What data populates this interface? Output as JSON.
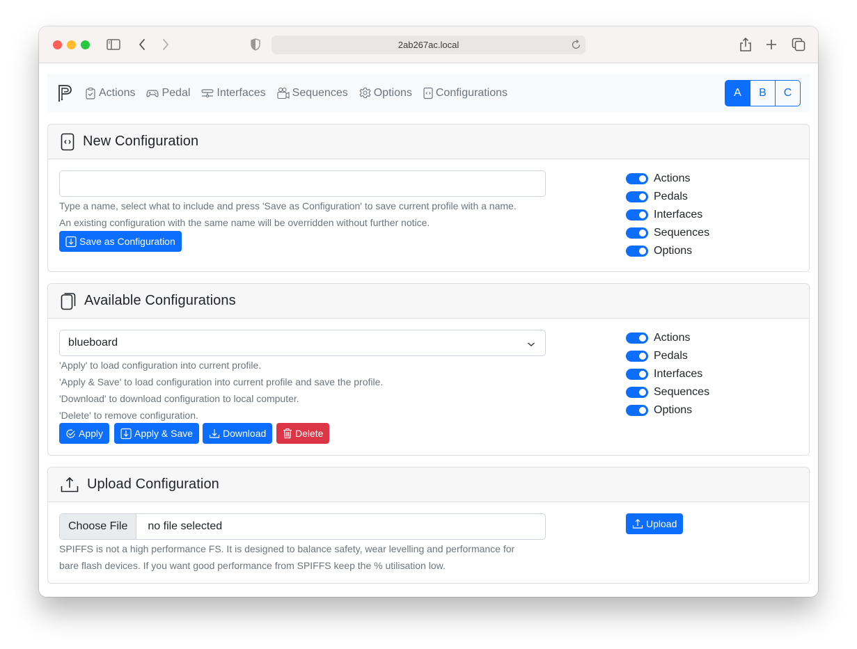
{
  "browser": {
    "url": "2ab267ac.local",
    "icons": [
      "sidebar-icon",
      "back-icon",
      "forward-icon",
      "shield-icon",
      "reload-icon",
      "share-icon",
      "new-tab-icon",
      "tabs-overview-icon"
    ]
  },
  "navbar": {
    "brand_icon": "pedal-logo-icon",
    "links": [
      {
        "label": "Actions",
        "icon": "clipboard-check-icon"
      },
      {
        "label": "Pedal",
        "icon": "controller-icon"
      },
      {
        "label": "Interfaces",
        "icon": "interfaces-icon"
      },
      {
        "label": "Sequences",
        "icon": "camera-reels-icon"
      },
      {
        "label": "Options",
        "icon": "gear-icon"
      },
      {
        "label": "Configurations",
        "icon": "file-code-icon"
      }
    ],
    "profiles": [
      {
        "label": "A",
        "active": true
      },
      {
        "label": "B",
        "active": false
      },
      {
        "label": "C",
        "active": false
      }
    ]
  },
  "new_config": {
    "title": "New Configuration",
    "name_value": "",
    "help": [
      "Type a name, select what to include and press 'Save as Configuration' to save current profile with a name.",
      "An existing configuration with the same name will be overridden without further notice."
    ],
    "save_label": "Save as Configuration",
    "switches": [
      {
        "label": "Actions",
        "on": true
      },
      {
        "label": "Pedals",
        "on": true
      },
      {
        "label": "Interfaces",
        "on": true
      },
      {
        "label": "Sequences",
        "on": true
      },
      {
        "label": "Options",
        "on": true
      }
    ]
  },
  "available_configs": {
    "title": "Available Configurations",
    "selected": "blueboard",
    "help": [
      "'Apply' to load configuration into current profile.",
      "'Apply & Save' to load configuration into current profile and save the profile.",
      "'Download' to download configuration to local computer.",
      "'Delete' to remove configuration."
    ],
    "buttons": {
      "apply": "Apply",
      "apply_save": "Apply & Save",
      "download": "Download",
      "delete": "Delete"
    },
    "switches": [
      {
        "label": "Actions",
        "on": true
      },
      {
        "label": "Pedals",
        "on": true
      },
      {
        "label": "Interfaces",
        "on": true
      },
      {
        "label": "Sequences",
        "on": true
      },
      {
        "label": "Options",
        "on": true
      }
    ]
  },
  "upload_config": {
    "title": "Upload Configuration",
    "choose_file_label": "Choose File",
    "file_status": "no file selected",
    "help": [
      "SPIFFS is not a high performance FS. It is designed to balance safety, wear levelling and performance for",
      "bare flash devices. If you want good performance from SPIFFS keep the % utilisation low."
    ],
    "upload_label": "Upload"
  },
  "colors": {
    "primary": "#0d6efd",
    "danger": "#dc3545",
    "muted": "#6c757d"
  }
}
